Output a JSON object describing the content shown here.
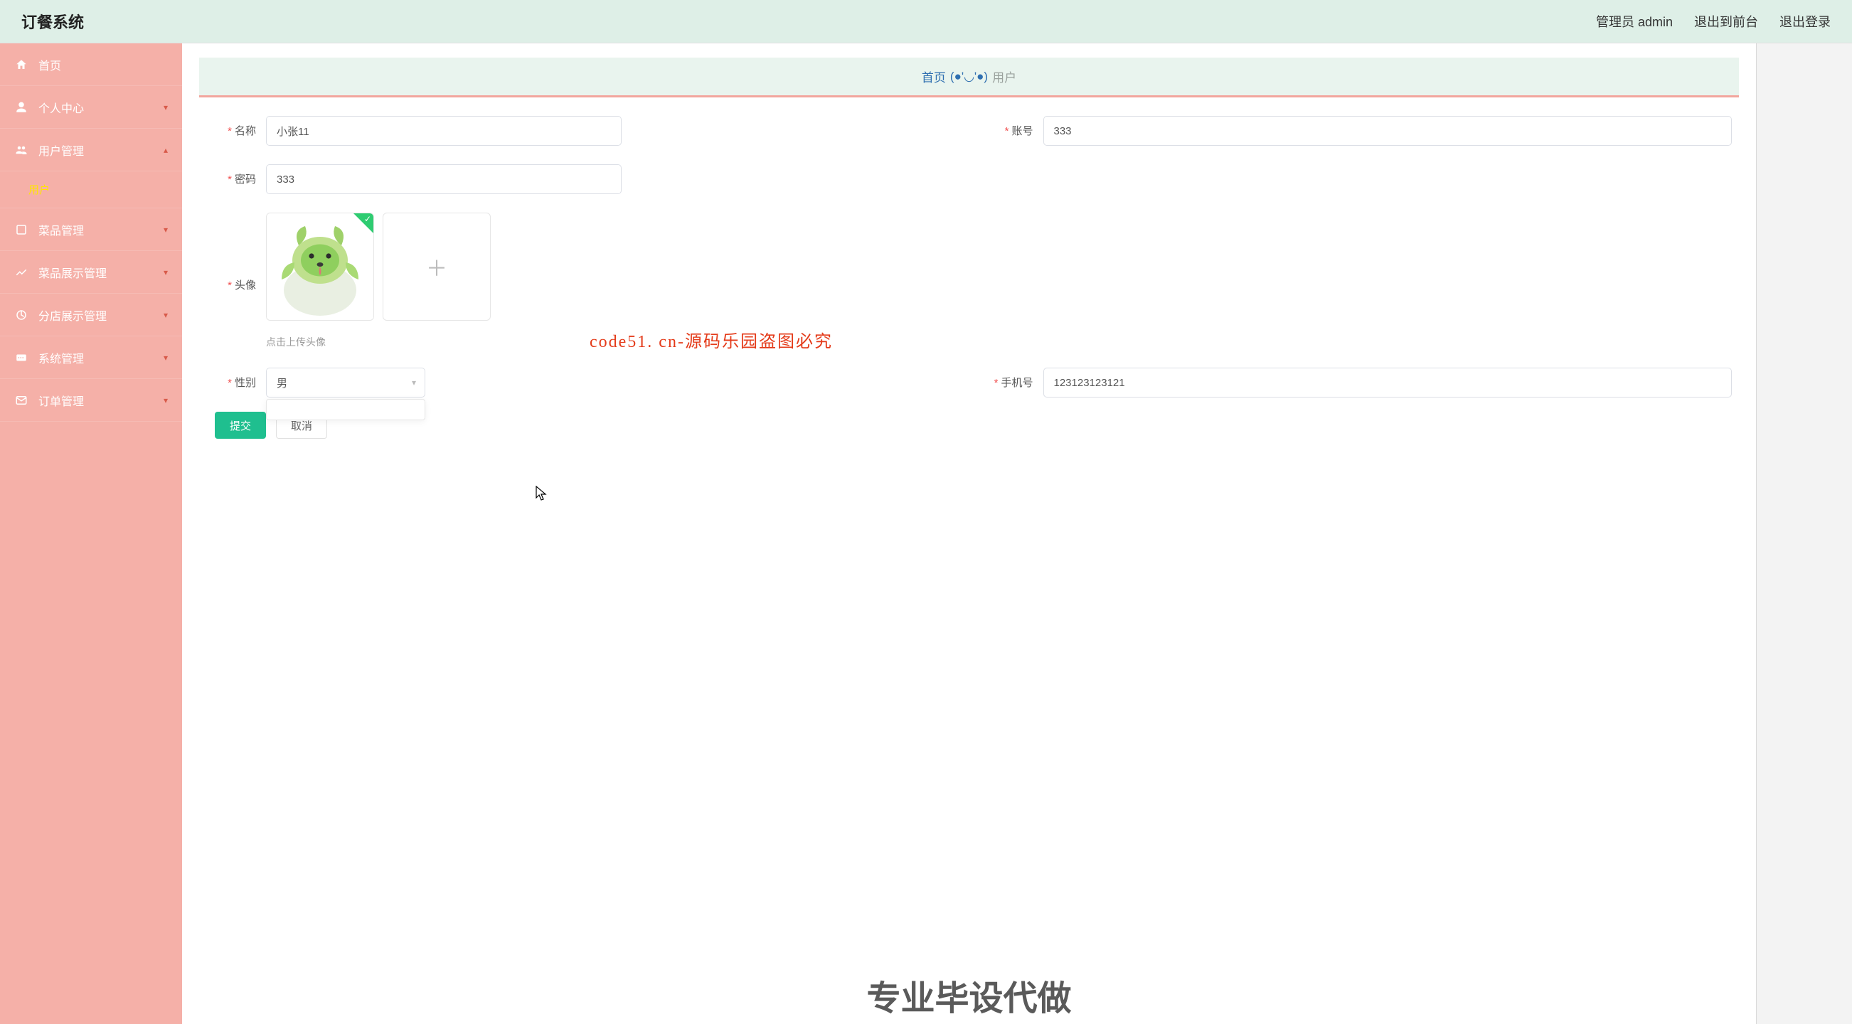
{
  "header": {
    "title": "订餐系统",
    "admin_label": "管理员 admin",
    "frontend_label": "退出到前台",
    "logout_label": "退出登录"
  },
  "sidebar": {
    "items": [
      {
        "icon": "home",
        "label": "首页",
        "expandable": false
      },
      {
        "icon": "user",
        "label": "个人中心",
        "expandable": true,
        "open": false
      },
      {
        "icon": "users",
        "label": "用户管理",
        "expandable": true,
        "open": true,
        "children": [
          {
            "label": "用户"
          }
        ]
      },
      {
        "icon": "dish",
        "label": "菜品管理",
        "expandable": true,
        "open": false
      },
      {
        "icon": "display",
        "label": "菜品展示管理",
        "expandable": true,
        "open": false
      },
      {
        "icon": "branch",
        "label": "分店展示管理",
        "expandable": true,
        "open": false
      },
      {
        "icon": "system",
        "label": "系统管理",
        "expandable": true,
        "open": false
      },
      {
        "icon": "order",
        "label": "订单管理",
        "expandable": true,
        "open": false
      }
    ]
  },
  "breadcrumb": {
    "home": "首页",
    "emoticon": "(●'◡'●)",
    "current": "用户"
  },
  "form": {
    "name": {
      "label": "名称",
      "value": "小张11"
    },
    "account": {
      "label": "账号",
      "value": "333"
    },
    "password": {
      "label": "密码",
      "value": "333"
    },
    "avatar": {
      "label": "头像",
      "hint": "点击上传头像"
    },
    "gender": {
      "label": "性别",
      "value": "男"
    },
    "phone": {
      "label": "手机号",
      "value": "123123123121"
    },
    "submit_label": "提交",
    "cancel_label": "取消"
  },
  "watermarks": {
    "line1": "code51. cn-源码乐园盗图必究",
    "line2": "专业毕设代做"
  }
}
